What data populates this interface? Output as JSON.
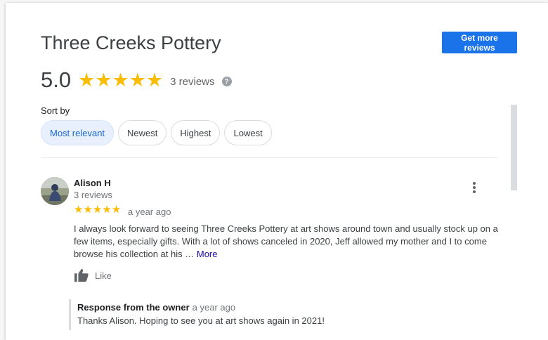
{
  "business": {
    "name": "Three Creeks Pottery",
    "rating": "5.0",
    "stars": "★★★★★",
    "review_count": "3 reviews",
    "help_symbol": "?"
  },
  "actions": {
    "get_more_reviews": "Get more reviews"
  },
  "sort": {
    "label": "Sort by",
    "options": [
      "Most relevant",
      "Newest",
      "Highest",
      "Lowest"
    ],
    "selected": "Most relevant"
  },
  "review": {
    "author": "Alison H",
    "author_reviews": "3 reviews",
    "stars": "★★★★★",
    "date": "a year ago",
    "text": "I always look forward to seeing Three Creeks Pottery at art shows around town and usually stock up on a few items, especially gifts. With a lot of shows canceled in 2020, Jeff allowed my mother and I to come browse his collection at his … ",
    "more": "More",
    "like": "Like",
    "owner_response": {
      "title": "Response from the owner",
      "date": "a year ago",
      "text": "Thanks Alison. Hoping to see you at art shows again in 2021!"
    }
  },
  "icons": [
    "help-icon",
    "more-vert-icon",
    "thumb-up-icon",
    "avatar-photo"
  ],
  "colors": {
    "accent": "#1a73e8",
    "star": "#fbbc04",
    "chip_selected_bg": "#e8f0fe",
    "link": "#1a0dab"
  }
}
